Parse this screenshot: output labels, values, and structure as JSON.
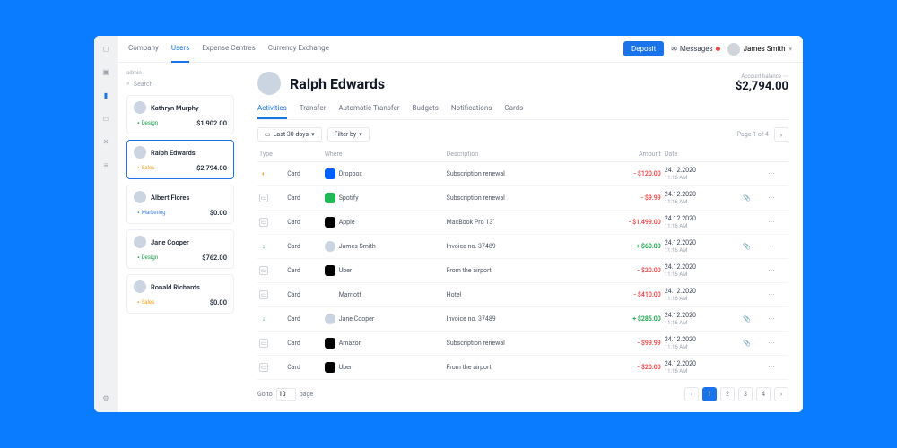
{
  "nav": {
    "items": [
      "Company",
      "Users",
      "Expense Centres",
      "Currency Exchange"
    ],
    "active": 1
  },
  "topbar": {
    "deposit": "Deposit",
    "messages": "Messages",
    "user": "James Smith"
  },
  "sidebar": {
    "breadcrumb": "admin",
    "search": "Search",
    "users": [
      {
        "name": "Kathryn Murphy",
        "tag": "Design",
        "tagClass": "design",
        "amount": "$1,902.00"
      },
      {
        "name": "Ralph Edwards",
        "tag": "Sales",
        "tagClass": "sales",
        "amount": "$2,794.00",
        "selected": true
      },
      {
        "name": "Albert Flores",
        "tag": "Marketing",
        "tagClass": "marketing",
        "amount": "$0.00"
      },
      {
        "name": "Jane Cooper",
        "tag": "Design",
        "tagClass": "design",
        "amount": "$762.00"
      },
      {
        "name": "Ronald Richards",
        "tag": "Sales",
        "tagClass": "sales",
        "amount": "$0.00"
      }
    ]
  },
  "panel": {
    "title": "Ralph Edwards",
    "balanceLabel": "Account balance",
    "balanceValue": "$2,794.00",
    "tabs": [
      "Activities",
      "Transfer",
      "Automatic Transfer",
      "Budgets",
      "Notifications",
      "Cards"
    ],
    "activeTab": 0,
    "filterDate": "Last 30 days",
    "filterBy": "Filter by",
    "pageInfo": "Page 1 of 4",
    "columns": {
      "type": "Type",
      "where": "Where",
      "desc": "Description",
      "amount": "Amount",
      "date": "Date"
    },
    "rows": [
      {
        "typeIcon": "pend",
        "type": "Card",
        "where": "Dropbox",
        "whereColor": "#0061ff",
        "desc": "Subscription renewal",
        "amount": "- $120.00",
        "sign": "neg",
        "date": "24.12.2020",
        "time": "11:16 AM",
        "att": false
      },
      {
        "typeIcon": "card",
        "type": "Card",
        "where": "Spotify",
        "whereColor": "#1db954",
        "desc": "Subscription renewal",
        "amount": "- $9.99",
        "sign": "neg",
        "date": "24.12.2020",
        "time": "11:16 AM",
        "att": true
      },
      {
        "typeIcon": "card",
        "type": "Card",
        "where": "Apple",
        "whereColor": "#000000",
        "desc": "MacBook Pro 13\"",
        "amount": "- $1,499.00",
        "sign": "neg",
        "date": "24.12.2020",
        "time": "11:16 AM",
        "att": false
      },
      {
        "typeIcon": "in",
        "type": "Card",
        "where": "James Smith",
        "whereColor": "av",
        "desc": "Invoice no. 37489",
        "amount": "+ $60.00",
        "sign": "pos",
        "date": "24.12.2020",
        "time": "11:16 AM",
        "att": true
      },
      {
        "typeIcon": "card",
        "type": "Card",
        "where": "Uber",
        "whereColor": "#000000",
        "desc": "From the airport",
        "amount": "- $20.00",
        "sign": "neg",
        "date": "24.12.2020",
        "time": "11:16 AM",
        "att": false
      },
      {
        "typeIcon": "card",
        "type": "Card",
        "where": "Marriott",
        "whereColor": "#ffffff",
        "desc": "Hotel",
        "amount": "- $410.00",
        "sign": "neg",
        "date": "24.12.2020",
        "time": "11:16 AM",
        "att": false
      },
      {
        "typeIcon": "in",
        "type": "Card",
        "where": "Jane Cooper",
        "whereColor": "av",
        "desc": "Invoice no. 37489",
        "amount": "+ $285.00",
        "sign": "pos",
        "date": "24.12.2020",
        "time": "11:16 AM",
        "att": true
      },
      {
        "typeIcon": "card",
        "type": "Card",
        "where": "Amazon",
        "whereColor": "#000000",
        "desc": "Subscription renewal",
        "amount": "- $99.99",
        "sign": "neg",
        "date": "24.12.2020",
        "time": "11:16 AM",
        "att": true
      },
      {
        "typeIcon": "card",
        "type": "Card",
        "where": "Uber",
        "whereColor": "#000000",
        "desc": "From the airport",
        "amount": "- $20.00",
        "sign": "neg",
        "date": "24.12.2020",
        "time": "11:16 AM",
        "att": false
      }
    ],
    "goto": "Go to",
    "gotoVal": "10",
    "pageWord": "page",
    "pages": [
      "1",
      "2",
      "3",
      "4"
    ],
    "activePage": 0
  }
}
